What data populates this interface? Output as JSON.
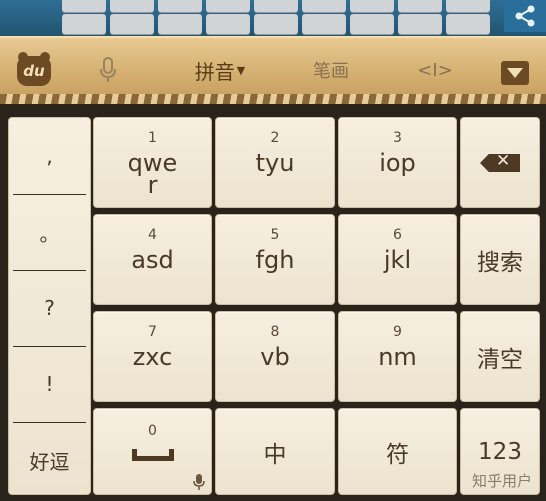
{
  "toolbar": {
    "logo_text": "du",
    "mode_pinyin": "拼音",
    "mode_bihua": "笔画",
    "cursor_symbol": "<I>"
  },
  "keys": {
    "k1": {
      "num": "1",
      "label": "qwe\nr"
    },
    "k2": {
      "num": "2",
      "label": "tyu"
    },
    "k3": {
      "num": "3",
      "label": "iop"
    },
    "k4": {
      "num": "4",
      "label": "asd"
    },
    "k5": {
      "num": "5",
      "label": "fgh"
    },
    "k6": {
      "num": "6",
      "label": "jkl"
    },
    "k7": {
      "num": "7",
      "label": "zxc"
    },
    "k8": {
      "num": "8",
      "label": "vb"
    },
    "k9": {
      "num": "9",
      "label": "nm"
    },
    "k0": {
      "num": "0"
    },
    "search": "搜索",
    "clear": "清空",
    "zhong": "中",
    "fu": "符",
    "num_mode": "123"
  },
  "punct": [
    ",",
    "。",
    "?",
    "!",
    "好逗"
  ],
  "watermark": "知乎用户"
}
